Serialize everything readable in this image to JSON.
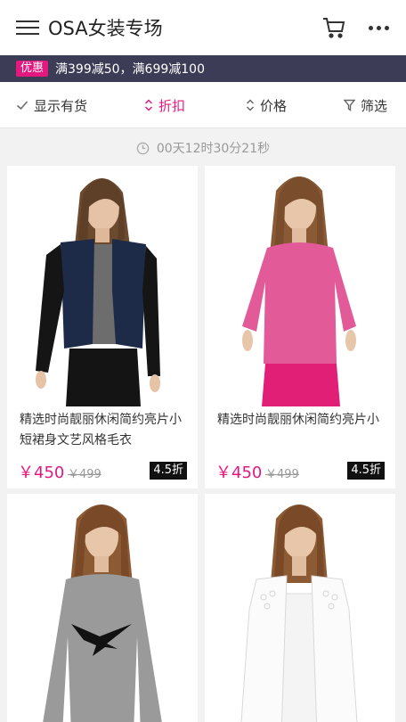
{
  "header": {
    "title": "OSA女装专场",
    "menu_icon": "hamburger-icon",
    "cart_icon": "cart-icon",
    "more_icon": "more-icon"
  },
  "promo": {
    "tag": "优惠",
    "text": "满399减50，满699减100"
  },
  "filters": [
    {
      "label": "显示有货",
      "icon": "check-icon"
    },
    {
      "label": "折扣",
      "icon": "sort-icon",
      "active": true
    },
    {
      "label": "价格",
      "icon": "sort-icon"
    },
    {
      "label": "筛选",
      "icon": "filter-icon"
    }
  ],
  "timer": {
    "text": "00天12时30分21秒",
    "icon": "clock-icon"
  },
  "colors": {
    "accent": "#e4197f",
    "promo_bg": "#3c3c57"
  },
  "products": [
    {
      "name": "精选时尚靓丽休闲简约亮片小短裙身文艺风格毛衣",
      "price": "￥450",
      "original_price": "￥499",
      "discount": "4.5折"
    },
    {
      "name": "精选时尚靓丽休闲简约亮片小",
      "price": "￥450",
      "original_price": "￥499",
      "discount": "4.5折"
    },
    {
      "name": "",
      "price": "",
      "original_price": "",
      "discount": ""
    },
    {
      "name": "",
      "price": "",
      "original_price": "",
      "discount": ""
    }
  ]
}
